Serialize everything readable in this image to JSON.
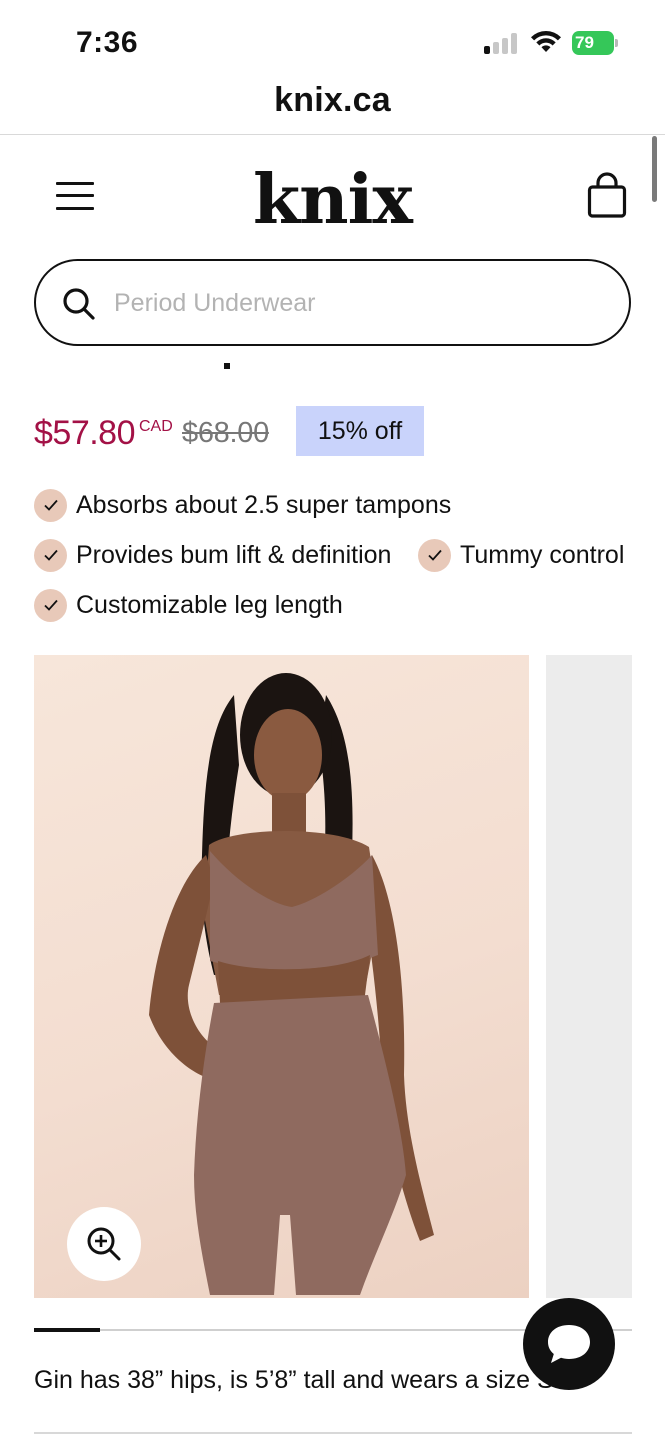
{
  "status_bar": {
    "time": "7:36",
    "battery": "79"
  },
  "browser": {
    "url": "knix.ca"
  },
  "header": {
    "logo": "knix"
  },
  "search": {
    "placeholder": "Period Underwear"
  },
  "product": {
    "price_sale": "$57.80",
    "currency": "CAD",
    "price_original": "$68.00",
    "discount": "15% off",
    "discount_fraction": 0.15,
    "features": [
      "Absorbs about 2.5 super tampons",
      "Provides bum lift & definition",
      "Tummy control",
      "Customizable leg length"
    ]
  },
  "gallery": {
    "progress_fraction": 0.11,
    "model_info": "Gin has 38” hips, is 5’8” tall and wears a size S"
  },
  "colors": {
    "sale_price": "#a31146",
    "discount_badge": "#c9d3fb",
    "check_badge": "#e8c9b9",
    "product_color": "#8f6a5f"
  },
  "icons": {
    "menu": "hamburger-icon",
    "cart": "shopping-bag-icon",
    "search": "search-icon",
    "zoom": "zoom-in-icon",
    "chat": "chat-bubble-icon",
    "feature": "checkmark-icon"
  }
}
